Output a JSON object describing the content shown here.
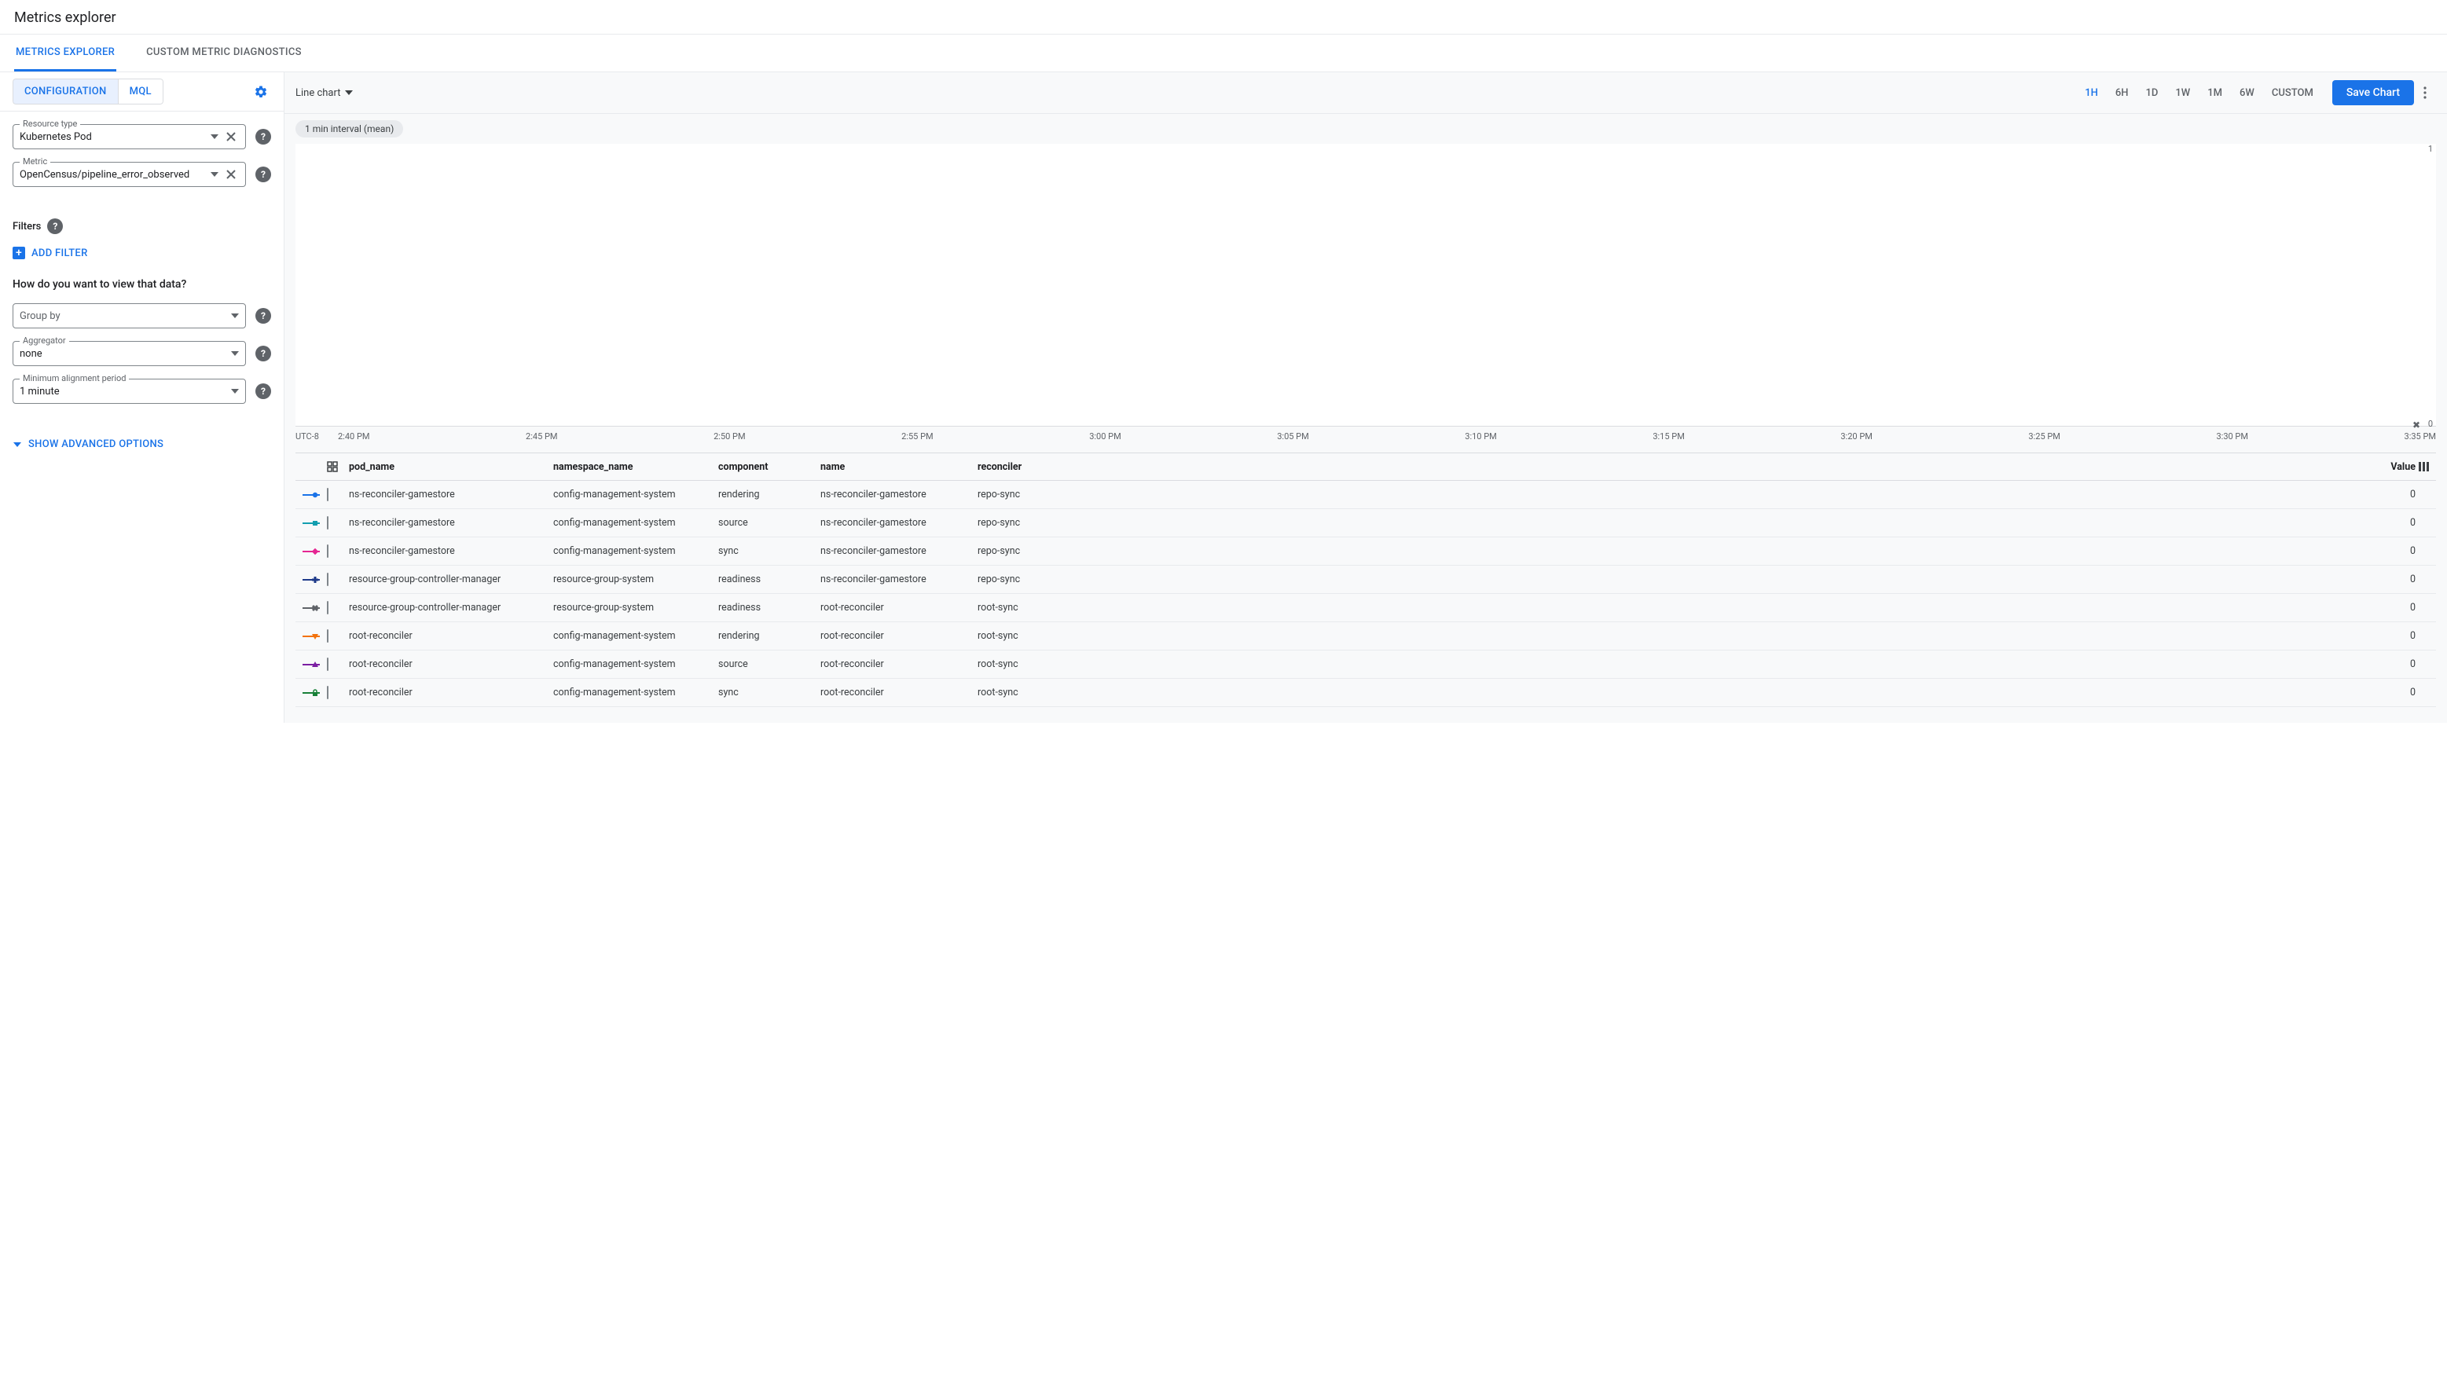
{
  "page_title": "Metrics explorer",
  "tabs": [
    {
      "label": "METRICS EXPLORER",
      "active": true
    },
    {
      "label": "CUSTOM METRIC DIAGNOSTICS",
      "active": false
    }
  ],
  "left_panel": {
    "mode_buttons": [
      {
        "id": "configuration",
        "label": "CONFIGURATION",
        "active": true
      },
      {
        "id": "mql",
        "label": "MQL",
        "active": false
      }
    ],
    "gear": "settings",
    "resource_type": {
      "label": "Resource type",
      "value": "Kubernetes Pod"
    },
    "metric": {
      "label": "Metric",
      "value": "OpenCensus/pipeline_error_observed"
    },
    "filters_label": "Filters",
    "add_filter_label": "ADD FILTER",
    "view_heading": "How do you want to view that data?",
    "group_by": {
      "label": "Group by",
      "value": ""
    },
    "aggregator": {
      "label": "Aggregator",
      "value": "none"
    },
    "min_align": {
      "label": "Minimum alignment period",
      "value": "1 minute"
    },
    "advanced_label": "SHOW ADVANCED OPTIONS"
  },
  "right_panel": {
    "chart_type": "Line chart",
    "ranges": [
      "1H",
      "6H",
      "1D",
      "1W",
      "1M",
      "6W",
      "CUSTOM"
    ],
    "active_range": "1H",
    "save_chart_label": "Save Chart",
    "interval_chip": "1 min interval (mean)",
    "y_top": "1",
    "y_bot": "0",
    "timezone": "UTC-8",
    "x_ticks": [
      "2:40 PM",
      "2:45 PM",
      "2:50 PM",
      "2:55 PM",
      "3:00 PM",
      "3:05 PM",
      "3:10 PM",
      "3:15 PM",
      "3:20 PM",
      "3:25 PM",
      "3:30 PM",
      "3:35 PM"
    ],
    "table_headers": [
      "pod_name",
      "namespace_name",
      "component",
      "name",
      "reconciler",
      "Value"
    ],
    "rows": [
      {
        "color": "#1a73e8",
        "shape": "circle",
        "pod": "ns-reconciler-gamestore",
        "ns": "config-management-system",
        "component": "rendering",
        "name": "ns-reconciler-gamestore",
        "reconciler": "repo-sync",
        "value": "0"
      },
      {
        "color": "#129eaf",
        "shape": "square",
        "pod": "ns-reconciler-gamestore",
        "ns": "config-management-system",
        "component": "source",
        "name": "ns-reconciler-gamestore",
        "reconciler": "repo-sync",
        "value": "0"
      },
      {
        "color": "#e52592",
        "shape": "diamond",
        "pod": "ns-reconciler-gamestore",
        "ns": "config-management-system",
        "component": "sync",
        "name": "ns-reconciler-gamestore",
        "reconciler": "repo-sync",
        "value": "0"
      },
      {
        "color": "#1e3a8a",
        "shape": "plus",
        "pod": "resource-group-controller-manager",
        "ns": "resource-group-system",
        "component": "readiness",
        "name": "ns-reconciler-gamestore",
        "reconciler": "repo-sync",
        "value": "0"
      },
      {
        "color": "#5f6368",
        "shape": "cross",
        "pod": "resource-group-controller-manager",
        "ns": "resource-group-system",
        "component": "readiness",
        "name": "root-reconciler",
        "reconciler": "root-sync",
        "value": "0"
      },
      {
        "color": "#f2720c",
        "shape": "tri-down",
        "pod": "root-reconciler",
        "ns": "config-management-system",
        "component": "rendering",
        "name": "root-reconciler",
        "reconciler": "root-sync",
        "value": "0"
      },
      {
        "color": "#7b1fa2",
        "shape": "tri-up",
        "pod": "root-reconciler",
        "ns": "config-management-system",
        "component": "source",
        "name": "root-reconciler",
        "reconciler": "root-sync",
        "value": "0"
      },
      {
        "color": "#188038",
        "shape": "lock",
        "pod": "root-reconciler",
        "ns": "config-management-system",
        "component": "sync",
        "name": "root-reconciler",
        "reconciler": "root-sync",
        "value": "0"
      }
    ]
  },
  "chart_data": {
    "type": "line",
    "title": "OpenCensus/pipeline_error_observed",
    "xlabel": "Time (UTC-8)",
    "ylabel": "",
    "ylim": [
      0,
      1
    ],
    "x_ticks": [
      "2:40 PM",
      "2:45 PM",
      "2:50 PM",
      "2:55 PM",
      "3:00 PM",
      "3:05 PM",
      "3:10 PM",
      "3:15 PM",
      "3:20 PM",
      "3:25 PM",
      "3:30 PM",
      "3:35 PM"
    ],
    "series": [
      {
        "name": "ns-reconciler-gamestore / rendering / repo-sync",
        "values": [
          0,
          0,
          0,
          0,
          0,
          0,
          0,
          0,
          0,
          0,
          0,
          0
        ]
      },
      {
        "name": "ns-reconciler-gamestore / source / repo-sync",
        "values": [
          0,
          0,
          0,
          0,
          0,
          0,
          0,
          0,
          0,
          0,
          0,
          0
        ]
      },
      {
        "name": "ns-reconciler-gamestore / sync / repo-sync",
        "values": [
          0,
          0,
          0,
          0,
          0,
          0,
          0,
          0,
          0,
          0,
          0,
          0
        ]
      },
      {
        "name": "resource-group-controller-manager / readiness / repo-sync",
        "values": [
          0,
          0,
          0,
          0,
          0,
          0,
          0,
          0,
          0,
          0,
          0,
          0
        ]
      },
      {
        "name": "resource-group-controller-manager / readiness / root-sync",
        "values": [
          0,
          0,
          0,
          0,
          0,
          0,
          0,
          0,
          0,
          0,
          0,
          0
        ]
      },
      {
        "name": "root-reconciler / rendering / root-sync",
        "values": [
          0,
          0,
          0,
          0,
          0,
          0,
          0,
          0,
          0,
          0,
          0,
          0
        ]
      },
      {
        "name": "root-reconciler / source / root-sync",
        "values": [
          0,
          0,
          0,
          0,
          0,
          0,
          0,
          0,
          0,
          0,
          0,
          0
        ]
      },
      {
        "name": "root-reconciler / sync / root-sync",
        "values": [
          0,
          0,
          0,
          0,
          0,
          0,
          0,
          0,
          0,
          0,
          0,
          0
        ]
      }
    ]
  }
}
